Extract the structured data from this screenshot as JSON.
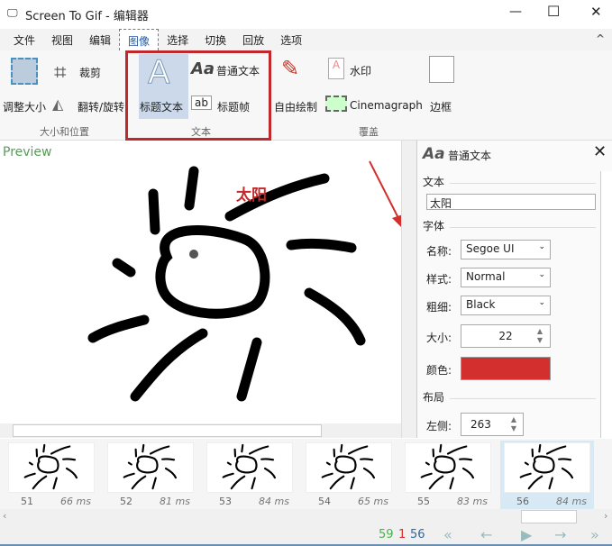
{
  "window": {
    "title": "Screen To Gif - 编辑器",
    "minimize": "—",
    "maximize": "☐",
    "close": "✕"
  },
  "menu": {
    "tabs": [
      "文件",
      "视图",
      "编辑",
      "图像",
      "选择",
      "切换",
      "回放",
      "选项"
    ],
    "active": "图像",
    "collapse": "^"
  },
  "ribbon": {
    "resize": "调整大小",
    "crop": "裁剪",
    "flip": "翻转/旋转",
    "group_size": "大小和位置",
    "title_text": "标题文本",
    "plain_text": "普通文本",
    "title_frame": "标题帧",
    "title_frame_icon": "ab",
    "group_text": "文本",
    "free_draw": "自由绘制",
    "watermark": "水印",
    "cinemagraph": "Cinemagraph",
    "border": "边框",
    "group_overlay": "覆盖"
  },
  "preview": {
    "label": "Preview",
    "overlay_text": "太阳"
  },
  "panel": {
    "title": "普通文本",
    "title_icon": "Aa",
    "section_text": "文本",
    "text_value": "太阳",
    "section_font": "字体",
    "name_label": "名称:",
    "name_value": "Segoe UI",
    "style_label": "样式:",
    "style_value": "Normal",
    "weight_label": "粗细:",
    "weight_value": "Black",
    "size_label": "大小:",
    "size_value": "22",
    "color_label": "颜色:",
    "color_value": "#d32f2f",
    "section_layout": "布局",
    "left_label": "左侧:",
    "left_value": "263"
  },
  "frames": [
    {
      "n": "51",
      "ms": "66 ms"
    },
    {
      "n": "52",
      "ms": "81 ms"
    },
    {
      "n": "53",
      "ms": "84 ms"
    },
    {
      "n": "54",
      "ms": "65 ms"
    },
    {
      "n": "55",
      "ms": "83 ms"
    },
    {
      "n": "56",
      "ms": "84 ms"
    }
  ],
  "status": {
    "total": "59",
    "selected_count": "1",
    "current": "56"
  },
  "colors": {
    "highlight": "#c62828",
    "accent": "#2a5a9a"
  }
}
